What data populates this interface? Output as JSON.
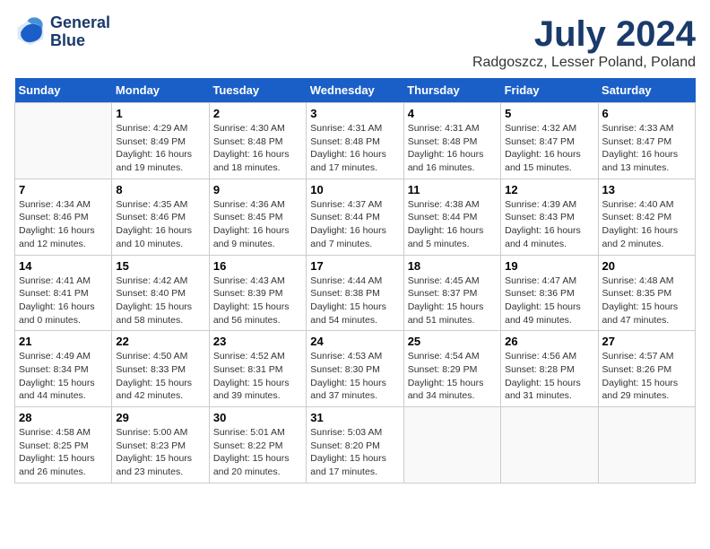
{
  "logo": {
    "line1": "General",
    "line2": "Blue"
  },
  "title": "July 2024",
  "subtitle": "Radgoszcz, Lesser Poland, Poland",
  "headers": [
    "Sunday",
    "Monday",
    "Tuesday",
    "Wednesday",
    "Thursday",
    "Friday",
    "Saturday"
  ],
  "weeks": [
    [
      {
        "day": "",
        "info": ""
      },
      {
        "day": "1",
        "info": "Sunrise: 4:29 AM\nSunset: 8:49 PM\nDaylight: 16 hours\nand 19 minutes."
      },
      {
        "day": "2",
        "info": "Sunrise: 4:30 AM\nSunset: 8:48 PM\nDaylight: 16 hours\nand 18 minutes."
      },
      {
        "day": "3",
        "info": "Sunrise: 4:31 AM\nSunset: 8:48 PM\nDaylight: 16 hours\nand 17 minutes."
      },
      {
        "day": "4",
        "info": "Sunrise: 4:31 AM\nSunset: 8:48 PM\nDaylight: 16 hours\nand 16 minutes."
      },
      {
        "day": "5",
        "info": "Sunrise: 4:32 AM\nSunset: 8:47 PM\nDaylight: 16 hours\nand 15 minutes."
      },
      {
        "day": "6",
        "info": "Sunrise: 4:33 AM\nSunset: 8:47 PM\nDaylight: 16 hours\nand 13 minutes."
      }
    ],
    [
      {
        "day": "7",
        "info": "Sunrise: 4:34 AM\nSunset: 8:46 PM\nDaylight: 16 hours\nand 12 minutes."
      },
      {
        "day": "8",
        "info": "Sunrise: 4:35 AM\nSunset: 8:46 PM\nDaylight: 16 hours\nand 10 minutes."
      },
      {
        "day": "9",
        "info": "Sunrise: 4:36 AM\nSunset: 8:45 PM\nDaylight: 16 hours\nand 9 minutes."
      },
      {
        "day": "10",
        "info": "Sunrise: 4:37 AM\nSunset: 8:44 PM\nDaylight: 16 hours\nand 7 minutes."
      },
      {
        "day": "11",
        "info": "Sunrise: 4:38 AM\nSunset: 8:44 PM\nDaylight: 16 hours\nand 5 minutes."
      },
      {
        "day": "12",
        "info": "Sunrise: 4:39 AM\nSunset: 8:43 PM\nDaylight: 16 hours\nand 4 minutes."
      },
      {
        "day": "13",
        "info": "Sunrise: 4:40 AM\nSunset: 8:42 PM\nDaylight: 16 hours\nand 2 minutes."
      }
    ],
    [
      {
        "day": "14",
        "info": "Sunrise: 4:41 AM\nSunset: 8:41 PM\nDaylight: 16 hours\nand 0 minutes."
      },
      {
        "day": "15",
        "info": "Sunrise: 4:42 AM\nSunset: 8:40 PM\nDaylight: 15 hours\nand 58 minutes."
      },
      {
        "day": "16",
        "info": "Sunrise: 4:43 AM\nSunset: 8:39 PM\nDaylight: 15 hours\nand 56 minutes."
      },
      {
        "day": "17",
        "info": "Sunrise: 4:44 AM\nSunset: 8:38 PM\nDaylight: 15 hours\nand 54 minutes."
      },
      {
        "day": "18",
        "info": "Sunrise: 4:45 AM\nSunset: 8:37 PM\nDaylight: 15 hours\nand 51 minutes."
      },
      {
        "day": "19",
        "info": "Sunrise: 4:47 AM\nSunset: 8:36 PM\nDaylight: 15 hours\nand 49 minutes."
      },
      {
        "day": "20",
        "info": "Sunrise: 4:48 AM\nSunset: 8:35 PM\nDaylight: 15 hours\nand 47 minutes."
      }
    ],
    [
      {
        "day": "21",
        "info": "Sunrise: 4:49 AM\nSunset: 8:34 PM\nDaylight: 15 hours\nand 44 minutes."
      },
      {
        "day": "22",
        "info": "Sunrise: 4:50 AM\nSunset: 8:33 PM\nDaylight: 15 hours\nand 42 minutes."
      },
      {
        "day": "23",
        "info": "Sunrise: 4:52 AM\nSunset: 8:31 PM\nDaylight: 15 hours\nand 39 minutes."
      },
      {
        "day": "24",
        "info": "Sunrise: 4:53 AM\nSunset: 8:30 PM\nDaylight: 15 hours\nand 37 minutes."
      },
      {
        "day": "25",
        "info": "Sunrise: 4:54 AM\nSunset: 8:29 PM\nDaylight: 15 hours\nand 34 minutes."
      },
      {
        "day": "26",
        "info": "Sunrise: 4:56 AM\nSunset: 8:28 PM\nDaylight: 15 hours\nand 31 minutes."
      },
      {
        "day": "27",
        "info": "Sunrise: 4:57 AM\nSunset: 8:26 PM\nDaylight: 15 hours\nand 29 minutes."
      }
    ],
    [
      {
        "day": "28",
        "info": "Sunrise: 4:58 AM\nSunset: 8:25 PM\nDaylight: 15 hours\nand 26 minutes."
      },
      {
        "day": "29",
        "info": "Sunrise: 5:00 AM\nSunset: 8:23 PM\nDaylight: 15 hours\nand 23 minutes."
      },
      {
        "day": "30",
        "info": "Sunrise: 5:01 AM\nSunset: 8:22 PM\nDaylight: 15 hours\nand 20 minutes."
      },
      {
        "day": "31",
        "info": "Sunrise: 5:03 AM\nSunset: 8:20 PM\nDaylight: 15 hours\nand 17 minutes."
      },
      {
        "day": "",
        "info": ""
      },
      {
        "day": "",
        "info": ""
      },
      {
        "day": "",
        "info": ""
      }
    ]
  ]
}
